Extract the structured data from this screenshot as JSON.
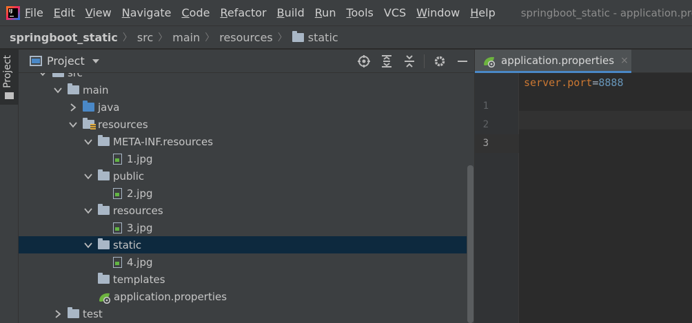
{
  "menubar": {
    "items": [
      {
        "mnemonic": "F",
        "rest": "ile"
      },
      {
        "mnemonic": "E",
        "rest": "dit"
      },
      {
        "mnemonic": "V",
        "rest": "iew"
      },
      {
        "mnemonic": "N",
        "rest": "avigate"
      },
      {
        "mnemonic": "C",
        "rest": "ode"
      },
      {
        "mnemonic": "R",
        "rest": "efactor"
      },
      {
        "mnemonic": "B",
        "rest": "uild"
      },
      {
        "mnemonic": "R",
        "rest": "un"
      },
      {
        "mnemonic": "T",
        "rest": "ools"
      },
      {
        "mnemonic": "",
        "rest": "VCS"
      },
      {
        "mnemonic": "W",
        "rest": "indow"
      },
      {
        "mnemonic": "H",
        "rest": "elp"
      }
    ],
    "window_title": "springboot_static - application.prope"
  },
  "breadcrumb": {
    "items": [
      "springboot_static",
      "src",
      "main",
      "resources",
      "static"
    ]
  },
  "tool_strip": {
    "project_tab_label": "Project"
  },
  "project_panel": {
    "title": "Project",
    "tree": [
      {
        "label": "src",
        "indent": 0,
        "arrow": "down",
        "icon": "folder"
      },
      {
        "label": "main",
        "indent": 1,
        "arrow": "down",
        "icon": "folder"
      },
      {
        "label": "java",
        "indent": 2,
        "arrow": "right",
        "icon": "folder-blue"
      },
      {
        "label": "resources",
        "indent": 2,
        "arrow": "down",
        "icon": "folder-res"
      },
      {
        "label": "META-INF.resources",
        "indent": 3,
        "arrow": "down",
        "icon": "folder"
      },
      {
        "label": "1.jpg",
        "indent": 4,
        "arrow": "",
        "icon": "image-file"
      },
      {
        "label": "public",
        "indent": 3,
        "arrow": "down",
        "icon": "folder"
      },
      {
        "label": "2.jpg",
        "indent": 4,
        "arrow": "",
        "icon": "image-file"
      },
      {
        "label": "resources",
        "indent": 3,
        "arrow": "down",
        "icon": "folder"
      },
      {
        "label": "3.jpg",
        "indent": 4,
        "arrow": "",
        "icon": "image-file"
      },
      {
        "label": "static",
        "indent": 3,
        "arrow": "down",
        "icon": "folder",
        "selected": true
      },
      {
        "label": "4.jpg",
        "indent": 4,
        "arrow": "",
        "icon": "image-file"
      },
      {
        "label": "templates",
        "indent": 3,
        "arrow": "",
        "icon": "folder"
      },
      {
        "label": "application.properties",
        "indent": 3,
        "arrow": "",
        "icon": "spring-properties"
      },
      {
        "label": "test",
        "indent": 1,
        "arrow": "right",
        "icon": "folder"
      }
    ]
  },
  "editor": {
    "tab": {
      "label": "application.properties",
      "close": "×"
    },
    "line_numbers": [
      "1",
      "2",
      "3"
    ],
    "code": {
      "key": "server.port",
      "eq": "=",
      "value": "8888"
    }
  },
  "colors": {
    "selection": "#0d293e",
    "tab_underline": "#4a88c7",
    "key": "#cc7832",
    "number": "#6897bb"
  }
}
